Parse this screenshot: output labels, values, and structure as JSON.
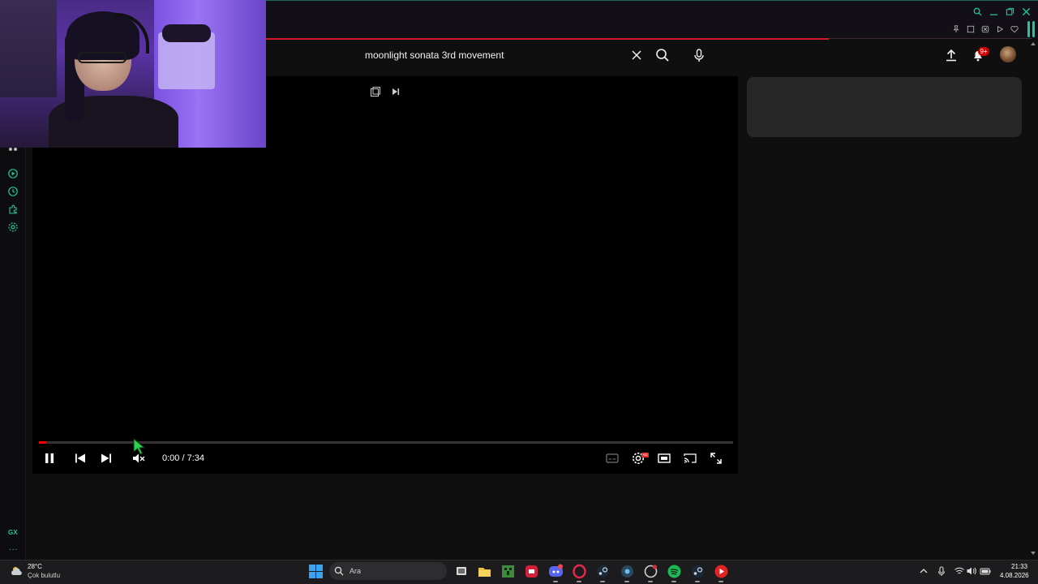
{
  "search": {
    "query": "moonlight sonata 3rd movement"
  },
  "header": {
    "notification_count": "9+"
  },
  "player": {
    "time_display": "0:00 / 7:34",
    "progress": 0.01,
    "quality_badge": "HD"
  },
  "sidebar": {
    "gx_label": "GX",
    "more_label": "..."
  },
  "taskbar": {
    "weather_temp": "28°C",
    "weather_desc": "Çok bulutlu",
    "search_placeholder": "Ara",
    "time": "21:33",
    "date": "4.08.2026",
    "apps": [
      "file-explorer",
      "minecraft",
      "app-red",
      "discord",
      "opera-gx",
      "steam",
      "steam-tools",
      "chrome-like",
      "spotify",
      "steam-2",
      "youtube"
    ]
  },
  "colors": {
    "accent_gx": "#22c79a",
    "youtube_red": "#ff0000",
    "background": "#0f0f0f"
  },
  "icons": {
    "browser_icons": [
      "search-icon",
      "minimize-icon",
      "maximize-icon",
      "close-icon"
    ],
    "tool_icons": [
      "pin-icon",
      "snapshot-icon",
      "shield-icon",
      "play-icon",
      "heart-icon"
    ],
    "sidebar_icons": [
      "player-icon",
      "history-icon",
      "extensions-icon",
      "settings-icon"
    ]
  }
}
